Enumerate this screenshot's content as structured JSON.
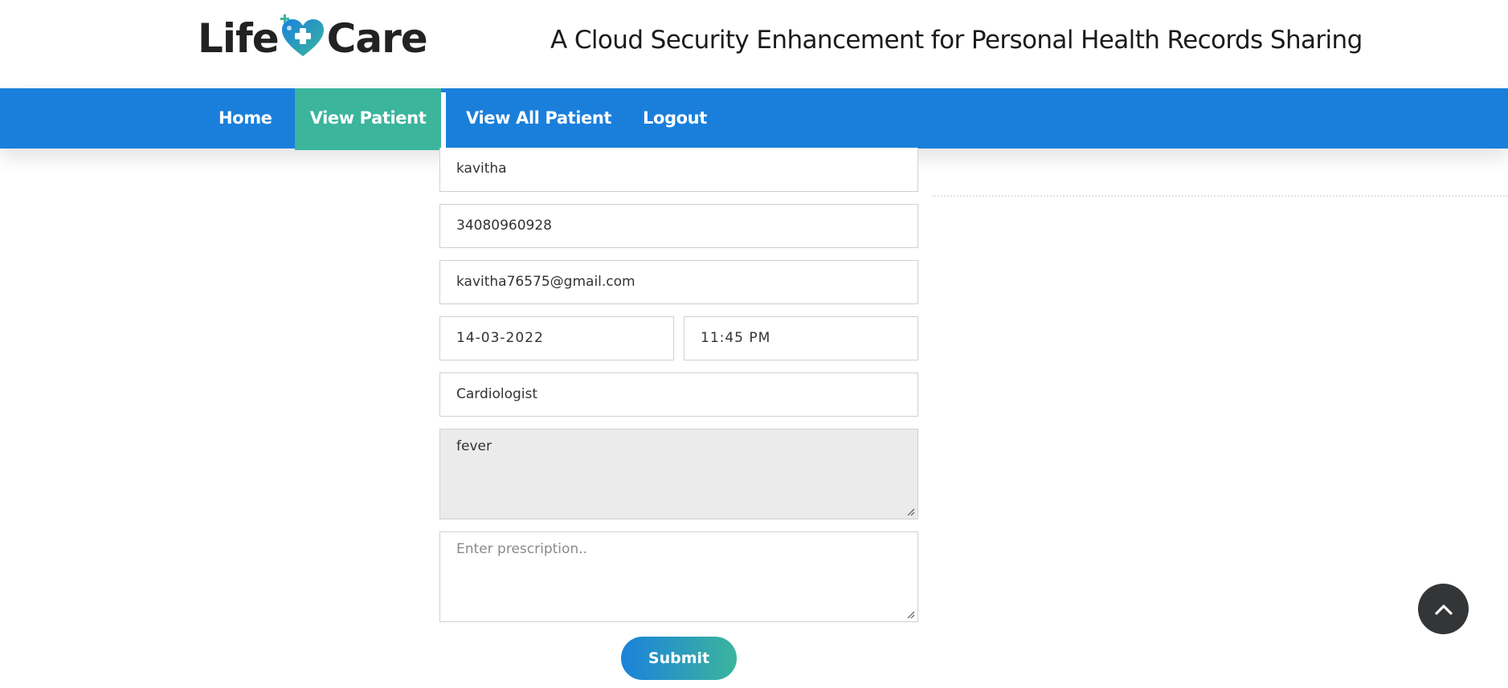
{
  "brand": {
    "logo_left": "Life",
    "logo_right": "Care",
    "tagline": "A Cloud Security Enhancement for Personal Health Records Sharing"
  },
  "nav": {
    "home": "Home",
    "view_patient": "View Patient",
    "view_all_patient": "View All Patient",
    "logout": "Logout",
    "active": "View Patient"
  },
  "form": {
    "name": "kavitha",
    "phone": "34080960928",
    "email": "kavitha76575@gmail.com",
    "date": "14-03-2022",
    "time": "11:45 PM",
    "specialization": "Cardiologist",
    "symptom": "fever",
    "prescription_placeholder": "Enter prescription..",
    "submit_label": "Submit"
  },
  "icons": {
    "logo": "heart-plus-icon",
    "scroll_top": "chevron-up-icon"
  },
  "colors": {
    "nav_bg": "#1a7fdb",
    "nav_active": "#3bb59c",
    "submit_from": "#1a82dc",
    "submit_to": "#3bb59c",
    "scroll_btn": "#333537"
  }
}
